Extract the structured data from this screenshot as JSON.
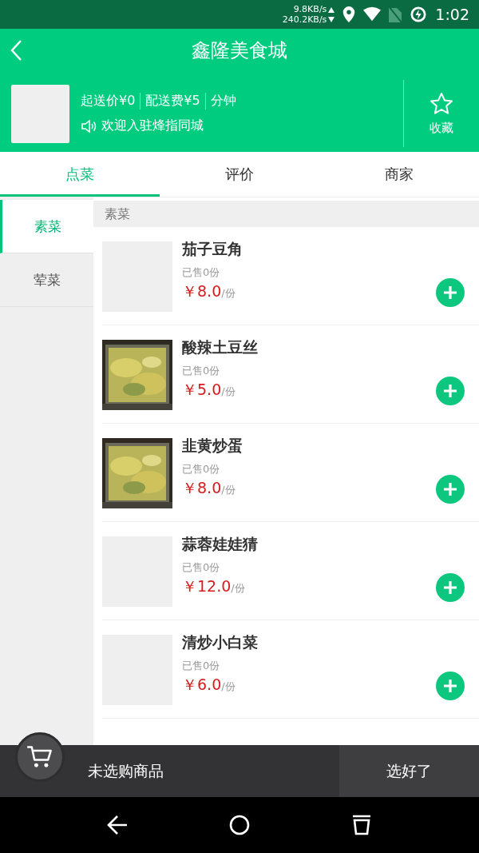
{
  "status_bar": {
    "speed_up": "9.8KB/s",
    "speed_down": "240.2KB/s",
    "time": "1:02"
  },
  "header": {
    "title": "鑫隆美食城"
  },
  "shop": {
    "min_order": "起送价¥0",
    "delivery_fee": "配送费¥5",
    "time": "分钟",
    "notice": "欢迎入驻烽指同城",
    "favorite_label": "收藏"
  },
  "tabs": [
    {
      "label": "点菜",
      "selected": true
    },
    {
      "label": "评价",
      "selected": false
    },
    {
      "label": "商家",
      "selected": false
    }
  ],
  "categories": [
    {
      "label": "素菜",
      "selected": true
    },
    {
      "label": "荤菜",
      "selected": false
    }
  ],
  "section_title": "素菜",
  "dishes": [
    {
      "name": "茄子豆角",
      "sold": "已售0份",
      "price": "￥8.0",
      "unit": "/份",
      "photo": false
    },
    {
      "name": "酸辣土豆丝",
      "sold": "已售0份",
      "price": "￥5.0",
      "unit": "/份",
      "photo": true
    },
    {
      "name": "韭黄炒蛋",
      "sold": "已售0份",
      "price": "￥8.0",
      "unit": "/份",
      "photo": true
    },
    {
      "name": "蒜蓉娃娃猜",
      "sold": "已售0份",
      "price": "￥12.0",
      "unit": "/份",
      "photo": false
    },
    {
      "name": "清炒小白菜",
      "sold": "已售0份",
      "price": "￥6.0",
      "unit": "/份",
      "photo": false
    }
  ],
  "cart": {
    "summary": "未选购商品",
    "checkout": "选好了"
  }
}
